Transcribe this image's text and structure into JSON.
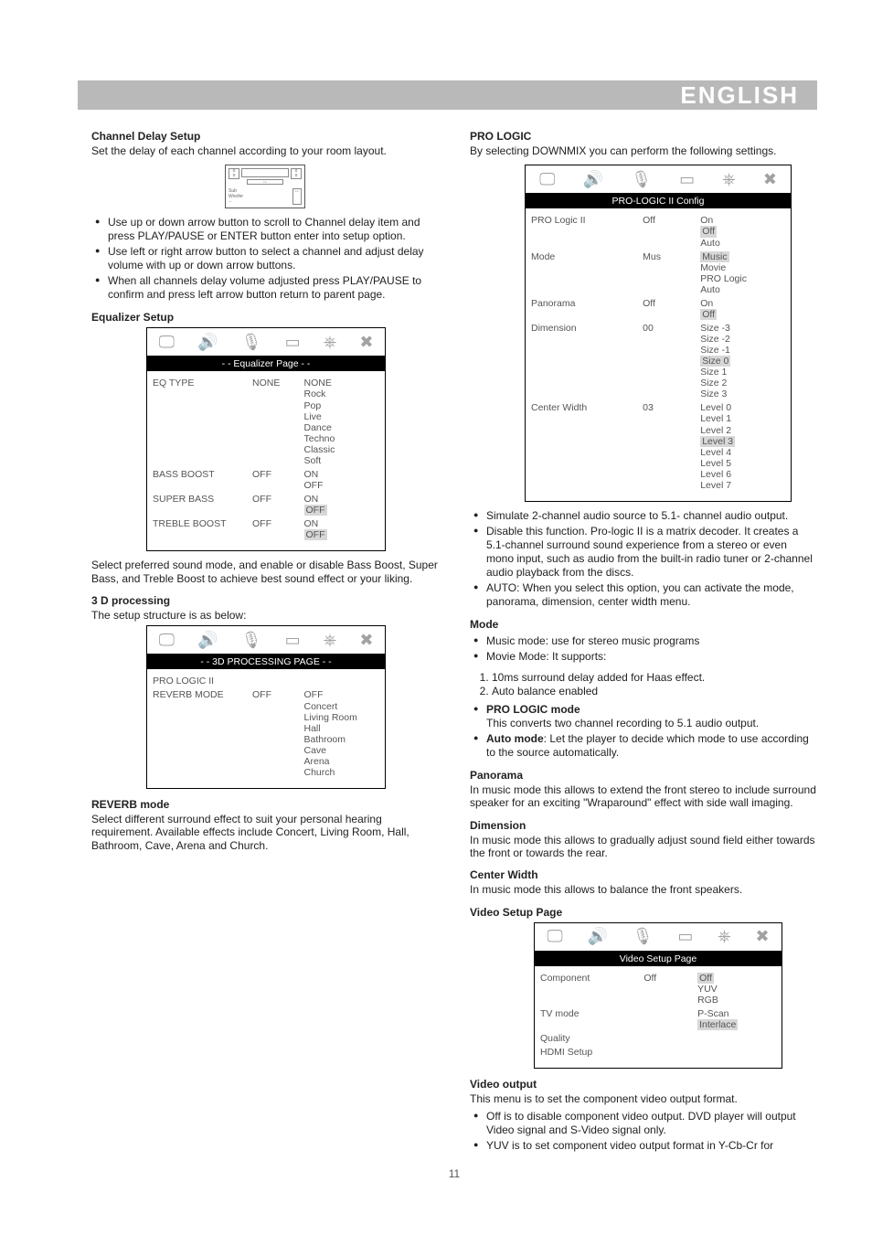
{
  "topbar": {
    "title": "ENGLISH"
  },
  "page_number": "11",
  "left": {
    "channel_delay": {
      "heading": "Channel Delay Setup",
      "intro": "Set the delay of each channel according to your room layout.",
      "bullets": [
        "Use up or down arrow button to scroll to Channel delay item and press PLAY/PAUSE or ENTER button enter into setup option.",
        "Use left or right arrow button to select a channel and adjust delay volume with up or down arrow buttons.",
        "When all channels delay volume adjusted press PLAY/PAUSE to confirm and press left arrow button return to parent page."
      ]
    },
    "equalizer": {
      "heading": "Equalizer Setup",
      "box_title": "- - Equalizer Page - -",
      "rows": [
        {
          "label": "EQ TYPE",
          "value": "NONE",
          "options": "NONE\nRock\nPop\nLive\nDance\nTechno\nClassic\nSoft"
        },
        {
          "label": "BASS BOOST",
          "value": "OFF",
          "options": "ON\nOFF"
        },
        {
          "label": "SUPER BASS",
          "value": "OFF",
          "options": "ON\nOFF",
          "hl": "OFF"
        },
        {
          "label": "TREBLE BOOST",
          "value": "OFF",
          "options": "ON\nOFF",
          "hl": "OFF"
        }
      ],
      "text": "Select preferred sound mode, and enable or disable Bass Boost, Super Bass, and Treble Boost to achieve best sound effect or your liking."
    },
    "threeD": {
      "heading": "3 D processing",
      "intro": "The setup structure is as below:",
      "box_title": "- - 3D PROCESSING   PAGE - -",
      "rows": [
        {
          "label": "PRO LOGIC II",
          "value": "",
          "options": ""
        },
        {
          "label": "REVERB MODE",
          "value": "OFF",
          "options": "OFF\nConcert\nLiving Room\nHall\nBathroom\nCave\nArena\nChurch"
        }
      ]
    },
    "reverb": {
      "heading": "REVERB mode",
      "text": "Select different surround effect to suit your personal hearing requirement. Available effects include Concert, Living Room, Hall, Bathroom, Cave, Arena and Church."
    }
  },
  "right": {
    "prologic": {
      "heading": "PRO LOGIC",
      "intro": "By selecting DOWNMIX you can perform the following settings.",
      "box_title": "PRO-LOGIC II Config",
      "rows": [
        {
          "label": "PRO Logic  II",
          "value": "Off",
          "options": "On\nOff\nAuto",
          "hl": "Off"
        },
        {
          "label": "Mode",
          "value": "Mus",
          "options": "Music\nMovie\nPRO Logic\nAuto",
          "hl": "Music"
        },
        {
          "label": "Panorama",
          "value": "Off",
          "options": "On\nOff",
          "hl": "Off"
        },
        {
          "label": "Dimension",
          "value": "00",
          "options": "Size -3\nSize -2\nSize -1\nSize 0\nSize 1\nSize 2\nSize 3",
          "hl": "Size 0"
        },
        {
          "label": "Center Width",
          "value": "03",
          "options": "Level 0\nLevel 1\nLevel 2\nLevel 3\nLevel 4\nLevel 5\nLevel 6\nLevel 7",
          "hl": "Level 3"
        }
      ],
      "bullets": [
        "Simulate 2-channel audio source to 5.1- channel audio output.",
        "Disable this function. Pro-logic II is a matrix decoder. It creates a 5.1-channel surround sound experience from a stereo or even mono input, such as audio from the built-in radio tuner or 2-channel audio playback from the discs.",
        "AUTO: When you select this option, you can activate the mode, panorama, dimension, center width menu."
      ]
    },
    "mode": {
      "heading": "Mode",
      "bullets": [
        "Music mode: use for stereo music programs",
        "Movie Mode: It supports:"
      ],
      "numbers": [
        "10ms surround delay added for Haas effect.",
        "Auto balance enabled"
      ],
      "bullets2": [
        {
          "label": "PRO LOGIC mode",
          "text": "This converts two channel recording to 5.1 audio output."
        },
        {
          "label": "Auto mode",
          "text": ": Let the player to decide which mode to use according to the source automatically."
        }
      ]
    },
    "panorama": {
      "heading": "Panorama",
      "text": "In music mode this allows to extend the front stereo to include surround speaker for an exciting \"Wraparound\" effect with side wall imaging."
    },
    "dimension": {
      "heading": "Dimension",
      "text": "In music mode this allows to gradually adjust sound field either towards the front or towards the rear."
    },
    "center_width": {
      "heading": "Center Width",
      "text": "In music mode this allows to balance the front speakers."
    },
    "video": {
      "heading": "Video Setup Page",
      "box_title": "Video Setup Page",
      "rows": [
        {
          "label": "Component",
          "value": "Off",
          "options": "Off\nYUV\nRGB",
          "hl": "Off"
        },
        {
          "label": "TV mode",
          "value": "",
          "options": "P-Scan\nInterlace",
          "hl": "Interlace"
        },
        {
          "label": "Quality",
          "value": "",
          "options": ""
        },
        {
          "label": "HDMI Setup",
          "value": "",
          "options": ""
        }
      ]
    },
    "video_output": {
      "heading": "Video output",
      "intro": "This menu is to set the component video output format.",
      "bullets": [
        "Off is to disable component video output. DVD player will output Video signal and S-Video signal only.",
        "YUV is to set component video output format in Y-Cb-Cr for"
      ]
    }
  },
  "icons": {
    "tab1": "🖵",
    "tab2": "🔊",
    "tab3": "🎙",
    "tab4": "▭",
    "tab5": "⎈",
    "tab6": "✖"
  }
}
